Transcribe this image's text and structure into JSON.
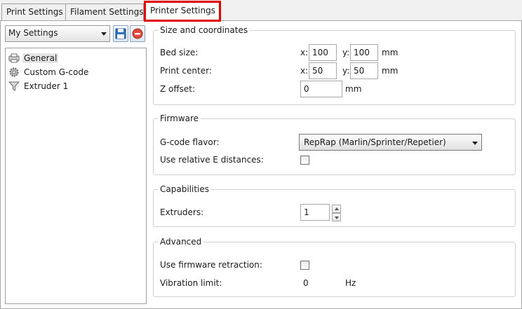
{
  "tabs": [
    {
      "label": "Print Settings"
    },
    {
      "label": "Filament Settings"
    },
    {
      "label": "Printer Settings"
    }
  ],
  "preset": {
    "selected": "My Settings"
  },
  "tree": {
    "items": [
      {
        "label": "General",
        "icon": "printer-icon"
      },
      {
        "label": "Custom G-code",
        "icon": "cog-icon"
      },
      {
        "label": "Extruder 1",
        "icon": "funnel-icon"
      }
    ]
  },
  "size_coords": {
    "title": "Size and coordinates",
    "bed_size": {
      "label": "Bed size:",
      "x_label": "x:",
      "x": "100",
      "y_label": "y:",
      "y": "100",
      "unit": "mm"
    },
    "print_center": {
      "label": "Print center:",
      "x_label": "x:",
      "x": "50",
      "y_label": "y:",
      "y": "50",
      "unit": "mm"
    },
    "z_offset": {
      "label": "Z offset:",
      "value": "0",
      "unit": "mm"
    }
  },
  "firmware": {
    "title": "Firmware",
    "gcode_flavor": {
      "label": "G-code flavor:",
      "value": "RepRap (Marlin/Sprinter/Repetier)"
    },
    "relative_e": {
      "label": "Use relative E distances:",
      "checked": false
    }
  },
  "capabilities": {
    "title": "Capabilities",
    "extruders": {
      "label": "Extruders:",
      "value": "1"
    }
  },
  "advanced": {
    "title": "Advanced",
    "firmware_retraction": {
      "label": "Use firmware retraction:",
      "checked": false
    },
    "vibration_limit": {
      "label": "Vibration limit:",
      "value": "0",
      "unit": "Hz"
    }
  },
  "colors": {
    "highlight_border": "#e00000",
    "panel_bg": "#ffffff",
    "window_bg": "#f0f0f0"
  }
}
